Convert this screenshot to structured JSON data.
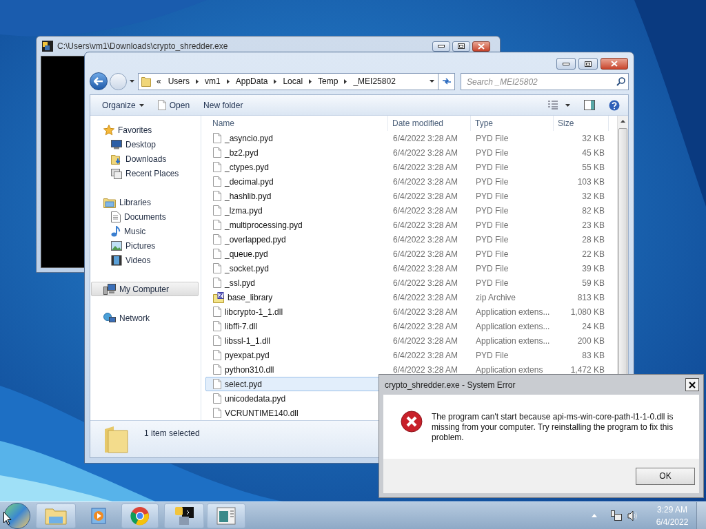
{
  "console_window": {
    "title": "C:\\Users\\vm1\\Downloads\\crypto_shredder.exe"
  },
  "explorer": {
    "address": {
      "overflow": "«",
      "segments": [
        "Users",
        "vm1",
        "AppData",
        "Local",
        "Temp",
        "_MEI25802"
      ]
    },
    "search": {
      "placeholder": "Search _MEI25802"
    },
    "toolbar": [
      {
        "label": "Organize",
        "kind": "menu"
      },
      {
        "label": "Open",
        "kind": "open"
      },
      {
        "label": "New folder",
        "kind": "plain"
      }
    ],
    "nav": [
      {
        "label": "Favorites",
        "selected": false,
        "children": [
          {
            "label": "Desktop",
            "selected": false
          },
          {
            "label": "Downloads",
            "selected": false
          },
          {
            "label": "Recent Places",
            "selected": false
          }
        ]
      },
      {
        "label": "Libraries",
        "selected": false,
        "children": [
          {
            "label": "Documents",
            "selected": false
          },
          {
            "label": "Music",
            "selected": false
          },
          {
            "label": "Pictures",
            "selected": false
          },
          {
            "label": "Videos",
            "selected": false
          }
        ]
      },
      {
        "label": "My Computer",
        "selected": true
      },
      {
        "label": "Network",
        "selected": false
      }
    ],
    "columns": [
      "Name",
      "Date modified",
      "Type",
      "Size"
    ],
    "files": [
      {
        "kind": "file",
        "name": "_asyncio.pyd",
        "date": "6/4/2022 3:28 AM",
        "type": "PYD File",
        "size": "32 KB",
        "selected": false
      },
      {
        "kind": "file",
        "name": "_bz2.pyd",
        "date": "6/4/2022 3:28 AM",
        "type": "PYD File",
        "size": "45 KB",
        "selected": false
      },
      {
        "kind": "file",
        "name": "_ctypes.pyd",
        "date": "6/4/2022 3:28 AM",
        "type": "PYD File",
        "size": "55 KB",
        "selected": false
      },
      {
        "kind": "file",
        "name": "_decimal.pyd",
        "date": "6/4/2022 3:28 AM",
        "type": "PYD File",
        "size": "103 KB",
        "selected": false
      },
      {
        "kind": "file",
        "name": "_hashlib.pyd",
        "date": "6/4/2022 3:28 AM",
        "type": "PYD File",
        "size": "32 KB",
        "selected": false
      },
      {
        "kind": "file",
        "name": "_lzma.pyd",
        "date": "6/4/2022 3:28 AM",
        "type": "PYD File",
        "size": "82 KB",
        "selected": false
      },
      {
        "kind": "file",
        "name": "_multiprocessing.pyd",
        "date": "6/4/2022 3:28 AM",
        "type": "PYD File",
        "size": "23 KB",
        "selected": false
      },
      {
        "kind": "file",
        "name": "_overlapped.pyd",
        "date": "6/4/2022 3:28 AM",
        "type": "PYD File",
        "size": "28 KB",
        "selected": false
      },
      {
        "kind": "file",
        "name": "_queue.pyd",
        "date": "6/4/2022 3:28 AM",
        "type": "PYD File",
        "size": "22 KB",
        "selected": false
      },
      {
        "kind": "file",
        "name": "_socket.pyd",
        "date": "6/4/2022 3:28 AM",
        "type": "PYD File",
        "size": "39 KB",
        "selected": false
      },
      {
        "kind": "file",
        "name": "_ssl.pyd",
        "date": "6/4/2022 3:28 AM",
        "type": "PYD File",
        "size": "59 KB",
        "selected": false
      },
      {
        "kind": "archive",
        "name": "base_library",
        "date": "6/4/2022 3:28 AM",
        "type": "zip Archive",
        "size": "813 KB",
        "selected": false
      },
      {
        "kind": "file",
        "name": "libcrypto-1_1.dll",
        "date": "6/4/2022 3:28 AM",
        "type": "Application extens...",
        "size": "1,080 KB",
        "selected": false
      },
      {
        "kind": "file",
        "name": "libffi-7.dll",
        "date": "6/4/2022 3:28 AM",
        "type": "Application extens...",
        "size": "24 KB",
        "selected": false
      },
      {
        "kind": "file",
        "name": "libssl-1_1.dll",
        "date": "6/4/2022 3:28 AM",
        "type": "Application extens...",
        "size": "200 KB",
        "selected": false
      },
      {
        "kind": "file",
        "name": "pyexpat.pyd",
        "date": "6/4/2022 3:28 AM",
        "type": "PYD File",
        "size": "83 KB",
        "selected": false
      },
      {
        "kind": "file",
        "name": "python310.dll",
        "date": "6/4/2022 3:28 AM",
        "type": "Application extens",
        "size": "1,472 KB",
        "selected": false
      },
      {
        "kind": "file",
        "name": "select.pyd",
        "selected": true
      },
      {
        "kind": "file",
        "name": "unicodedata.pyd",
        "selected": false
      },
      {
        "kind": "file",
        "name": "VCRUNTIME140.dll",
        "selected": false
      }
    ],
    "status": "1 item selected"
  },
  "dialog": {
    "title": "crypto_shredder.exe - System Error",
    "message": "The program can't start because api-ms-win-core-path-l1-1-0.dll is missing from your computer. Try reinstalling the program to fix this problem.",
    "button": "OK"
  },
  "clock": {
    "time": "3:29 AM",
    "date": "6/4/2022"
  }
}
